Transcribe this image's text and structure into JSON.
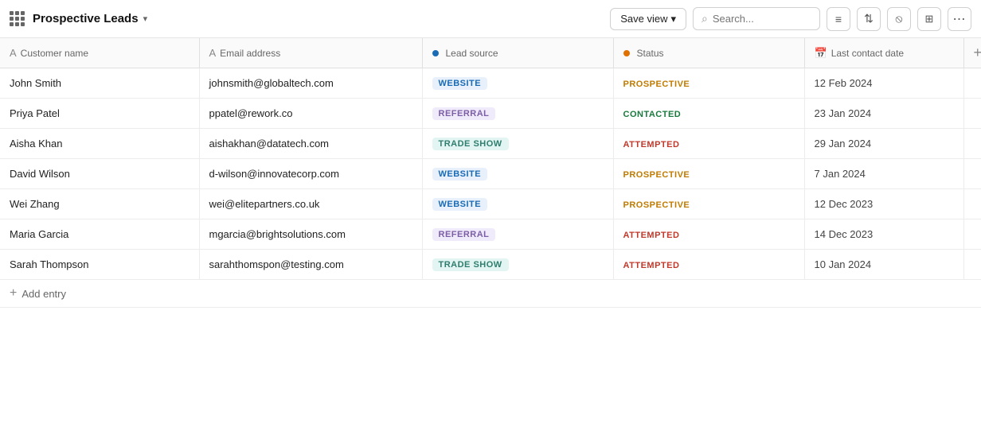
{
  "app": {
    "title": "Prospective Leads",
    "grid_icon": true
  },
  "toolbar": {
    "save_view_label": "Save view",
    "search_placeholder": "Search...",
    "chevron_down": "▾",
    "filter_icon": "⊟",
    "sort_icon": "↕",
    "hide_icon": "⊘",
    "view_icon": "⊞",
    "more_icon": "···"
  },
  "table": {
    "columns": [
      {
        "id": "customer_name",
        "label": "Customer name",
        "icon": "text-icon"
      },
      {
        "id": "email_address",
        "label": "Email address",
        "icon": "text-icon"
      },
      {
        "id": "lead_source",
        "label": "Lead source",
        "icon": "dot-icon"
      },
      {
        "id": "status",
        "label": "Status",
        "icon": "dot-icon"
      },
      {
        "id": "last_contact_date",
        "label": "Last contact date",
        "icon": "calendar-icon"
      }
    ],
    "rows": [
      {
        "customer_name": "John Smith",
        "email": "johnsmith@globaltech.com",
        "lead_source": "WEBSITE",
        "lead_source_type": "website",
        "status": "PROSPECTIVE",
        "status_type": "prospective",
        "last_contact": "12 Feb 2024"
      },
      {
        "customer_name": "Priya Patel",
        "email": "ppatel@rework.co",
        "lead_source": "REFERRAL",
        "lead_source_type": "referral",
        "status": "CONTACTED",
        "status_type": "contacted",
        "last_contact": "23 Jan 2024"
      },
      {
        "customer_name": "Aisha Khan",
        "email": "aishakhan@datatech.com",
        "lead_source": "TRADE SHOW",
        "lead_source_type": "tradeshow",
        "status": "ATTEMPTED",
        "status_type": "attempted",
        "last_contact": "29 Jan 2024"
      },
      {
        "customer_name": "David Wilson",
        "email": "d-wilson@innovatecorp.com",
        "lead_source": "WEBSITE",
        "lead_source_type": "website",
        "status": "PROSPECTIVE",
        "status_type": "prospective",
        "last_contact": "7 Jan 2024"
      },
      {
        "customer_name": "Wei Zhang",
        "email": "wei@elitepartners.co.uk",
        "lead_source": "WEBSITE",
        "lead_source_type": "website",
        "status": "PROSPECTIVE",
        "status_type": "prospective",
        "last_contact": "12 Dec 2023"
      },
      {
        "customer_name": "Maria Garcia",
        "email": "mgarcia@brightsolutions.com",
        "lead_source": "REFERRAL",
        "lead_source_type": "referral",
        "status": "ATTEMPTED",
        "status_type": "attempted",
        "last_contact": "14 Dec 2023"
      },
      {
        "customer_name": "Sarah Thompson",
        "email": "sarahthomspon@testing.com",
        "lead_source": "TRADE SHOW",
        "lead_source_type": "tradeshow",
        "status": "ATTEMPTED",
        "status_type": "attempted",
        "last_contact": "10 Jan 2024"
      }
    ],
    "add_entry_label": "Add entry"
  }
}
